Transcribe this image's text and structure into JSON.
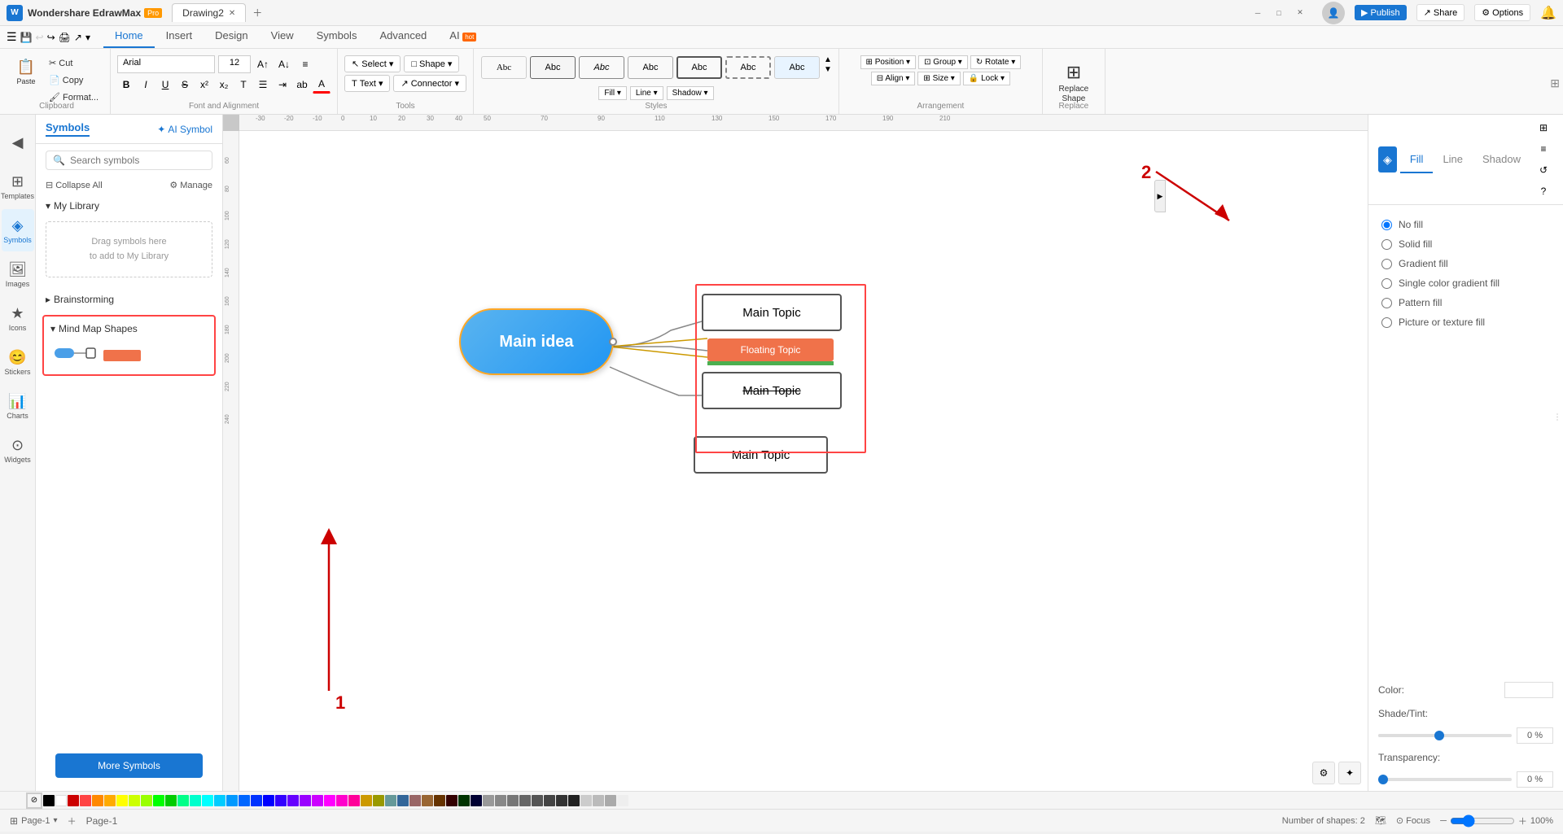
{
  "app": {
    "name": "Wondershare EdrawMax",
    "badge": "Pro",
    "document": "Drawing2",
    "window_buttons": [
      "minimize",
      "maximize",
      "close"
    ]
  },
  "ribbon": {
    "tabs": [
      "Home",
      "Insert",
      "Design",
      "View",
      "Symbols",
      "Advanced",
      "AI"
    ],
    "active_tab": "Home",
    "groups": {
      "clipboard": {
        "label": "Clipboard",
        "buttons": [
          "Paste",
          "Cut",
          "Copy",
          "Format Painter"
        ]
      },
      "font": {
        "label": "Font and Alignment",
        "font": "Arial",
        "size": "12",
        "bold": "B",
        "italic": "I",
        "underline": "U"
      },
      "tools": {
        "label": "Tools",
        "select": "Select ▾",
        "shape": "Shape ▾",
        "text": "Text ▾",
        "connector": "Connector ▾"
      },
      "styles": {
        "label": "Styles",
        "items": [
          "Abc",
          "Abc",
          "Abc",
          "Abc",
          "Abc",
          "Abc",
          "Abc"
        ]
      },
      "fill": {
        "label": "Fill ▾"
      },
      "line": {
        "label": "Line ▾"
      },
      "shadow": {
        "label": "Shadow ▾"
      },
      "arrangement": {
        "label": "Arrangement",
        "position": "Position ▾",
        "group": "Group ▾",
        "rotate": "Rotate ▾",
        "align": "Align ▾",
        "size": "Size ▾",
        "lock": "Lock ▾"
      },
      "replace": {
        "label": "Replace",
        "replace_shape": "Replace\nShape"
      }
    }
  },
  "left_sidebar": {
    "items": [
      {
        "id": "collapse",
        "icon": "◀",
        "label": ""
      },
      {
        "id": "templates",
        "icon": "⊞",
        "label": "Templates"
      },
      {
        "id": "symbols",
        "icon": "◈",
        "label": "Symbols",
        "active": true
      },
      {
        "id": "images",
        "icon": "🖼",
        "label": "Images"
      },
      {
        "id": "icons",
        "icon": "★",
        "label": "Icons"
      },
      {
        "id": "stickers",
        "icon": "😊",
        "label": "Stickers"
      },
      {
        "id": "charts",
        "icon": "📊",
        "label": "Charts"
      },
      {
        "id": "widgets",
        "icon": "⊙",
        "label": "Widgets"
      }
    ]
  },
  "symbols_panel": {
    "title": "Symbols",
    "ai_symbol_label": "AI Symbol",
    "search_placeholder": "Search symbols",
    "collapse_all": "Collapse All",
    "manage": "Manage",
    "my_library": {
      "title": "My Library",
      "drop_text": "Drag symbols here\nto add to My Library"
    },
    "brainstorming": {
      "title": "Brainstorming"
    },
    "mind_map": {
      "title": "Mind Map Shapes",
      "expanded": true
    },
    "more_symbols": "More Symbols"
  },
  "canvas": {
    "shapes": {
      "main_idea": "Main idea",
      "main_topic_1": "Main Topic",
      "floating_topic": "Floating Topic",
      "main_topic_3": "Main Topic",
      "main_topic_4": "Main Topic"
    },
    "annotations": {
      "number_1": "1",
      "number_2": "2"
    }
  },
  "right_panel": {
    "tabs": [
      "Fill",
      "Line",
      "Shadow"
    ],
    "active_tab": "Fill",
    "fill_options": [
      {
        "id": "no_fill",
        "label": "No fill",
        "selected": true
      },
      {
        "id": "solid_fill",
        "label": "Solid fill"
      },
      {
        "id": "gradient_fill",
        "label": "Gradient fill"
      },
      {
        "id": "single_color",
        "label": "Single color gradient fill"
      },
      {
        "id": "pattern_fill",
        "label": "Pattern fill"
      },
      {
        "id": "picture_fill",
        "label": "Picture or texture fill"
      }
    ],
    "color_label": "Color:",
    "shade_label": "Shade/Tint:",
    "shade_value": "0 %",
    "transparency_label": "Transparency:",
    "transparency_value": "0 %"
  },
  "status_bar": {
    "page": "Page-1",
    "shapes_count": "Number of shapes: 2",
    "zoom": "100%",
    "focus": "Focus"
  },
  "color_palette": {
    "colors": [
      "#000000",
      "#ffffff",
      "#ff0000",
      "#ff4444",
      "#ff6600",
      "#ff9900",
      "#ffcc00",
      "#ffff00",
      "#ccff00",
      "#99ff00",
      "#66ff00",
      "#33ff00",
      "#00ff00",
      "#00ff33",
      "#00ff66",
      "#00ff99",
      "#00ffcc",
      "#00ffff",
      "#00ccff",
      "#0099ff",
      "#0066ff",
      "#0033ff",
      "#0000ff",
      "#3300ff",
      "#6600ff",
      "#9900ff",
      "#cc00ff",
      "#ff00ff",
      "#ff00cc",
      "#ff0099",
      "#ff0066",
      "#ff0033",
      "#cc0000",
      "#990000",
      "#660000",
      "#330000",
      "#003300",
      "#006600",
      "#009900",
      "#00cc00",
      "#000033",
      "#000066",
      "#000099",
      "#0000cc",
      "#cc9900",
      "#cccc00",
      "#99cc00",
      "#66cc00",
      "#33cc00",
      "#00cc33",
      "#00cc66",
      "#00cc99",
      "#00cccc",
      "#0099cc",
      "#0066cc",
      "#9966cc",
      "#cc6699",
      "#996633",
      "#663300",
      "#999999",
      "#888888",
      "#777777",
      "#666666",
      "#555555",
      "#444444",
      "#333333",
      "#222222",
      "#111111",
      "#cccccc",
      "#bbbbbb",
      "#aaaaaa"
    ]
  }
}
